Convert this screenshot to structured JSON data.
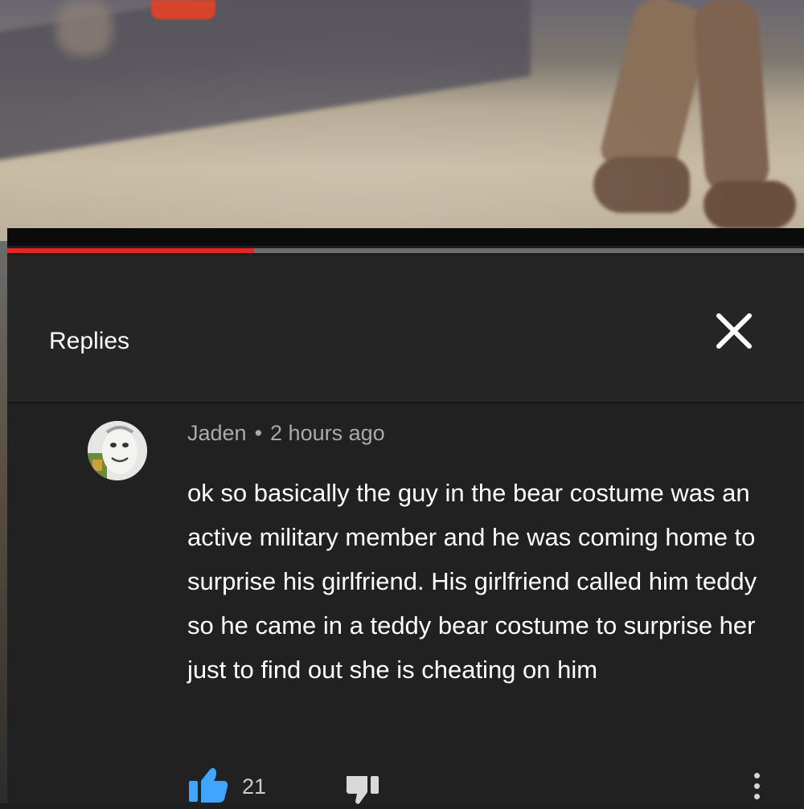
{
  "video": {
    "progress_fraction": 0.31,
    "progress_color": "#e52521",
    "track_color": "#6e6e6e"
  },
  "replies_panel": {
    "title": "Replies",
    "close_icon": "close-icon"
  },
  "comment": {
    "author": "Jaden",
    "separator": "•",
    "timestamp": "2 hours ago",
    "avatar_icon": "user-avatar",
    "text": "ok so basically the guy in the bear costume was an active military member and he was coming home to surprise his girlfriend. His girlfriend called him teddy so he came in a teddy bear costume to surprise her just to find out she is cheating on him",
    "like_icon": "thumbs-up-icon",
    "like_count": "21",
    "dislike_icon": "thumbs-down-icon",
    "more_icon": "more-vertical-icon",
    "like_color": "#3ea6ff"
  }
}
